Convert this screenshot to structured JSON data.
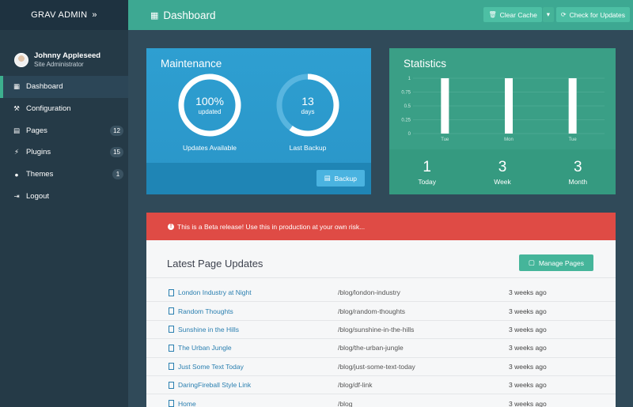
{
  "brand": {
    "title": "GRAV ADMIN",
    "chevron": "»"
  },
  "user": {
    "name": "Johnny Appleseed",
    "role": "Site Administrator"
  },
  "nav": [
    {
      "label": "Dashboard",
      "icon": "grid-icon",
      "active": true
    },
    {
      "label": "Configuration",
      "icon": "wrench-icon"
    },
    {
      "label": "Pages",
      "icon": "file-icon",
      "badge": "12"
    },
    {
      "label": "Plugins",
      "icon": "plug-icon",
      "badge": "15"
    },
    {
      "label": "Themes",
      "icon": "tint-icon",
      "badge": "1"
    },
    {
      "label": "Logout",
      "icon": "sign-out-icon"
    }
  ],
  "header": {
    "title": "Dashboard",
    "clear_cache": "Clear Cache",
    "check_updates": "Check for Updates"
  },
  "maintenance": {
    "title": "Maintenance",
    "updates_value": "100%",
    "updates_unit": "updated",
    "updates_label": "Updates Available",
    "updates_fraction": 1.0,
    "backup_value": "13",
    "backup_unit": "days",
    "backup_label": "Last Backup",
    "backup_fraction": 0.6,
    "backup_button": "Backup"
  },
  "statistics": {
    "title": "Statistics",
    "today_value": "1",
    "today_label": "Today",
    "week_value": "3",
    "week_label": "Week",
    "month_value": "3",
    "month_label": "Month"
  },
  "chart_data": {
    "type": "bar",
    "categories": [
      "Tue",
      "Mon",
      "Tue"
    ],
    "values": [
      1,
      1,
      1
    ],
    "yticks": [
      "1",
      "0.75",
      "0.5",
      "0.25",
      "0"
    ],
    "ylim": [
      0,
      1
    ],
    "grid": true
  },
  "alert": {
    "text": "This is a Beta release! Use this in production at your own risk..."
  },
  "updates": {
    "title": "Latest Page Updates",
    "manage_button": "Manage Pages",
    "rows": [
      {
        "title": "London Industry at Night",
        "route": "/blog/london-industry",
        "time": "3 weeks ago"
      },
      {
        "title": "Random Thoughts",
        "route": "/blog/random-thoughts",
        "time": "3 weeks ago"
      },
      {
        "title": "Sunshine in the Hills",
        "route": "/blog/sunshine-in-the-hills",
        "time": "3 weeks ago"
      },
      {
        "title": "The Urban Jungle",
        "route": "/blog/the-urban-jungle",
        "time": "3 weeks ago"
      },
      {
        "title": "Just Some Text Today",
        "route": "/blog/just-some-text-today",
        "time": "3 weeks ago"
      },
      {
        "title": "DaringFireball Style Link",
        "route": "/blog/df-link",
        "time": "3 weeks ago"
      },
      {
        "title": "Home",
        "route": "/blog",
        "time": "3 weeks ago"
      }
    ]
  },
  "colors": {
    "sidebar": "#253a47",
    "header": "#3da892",
    "maintenance": "#2e9fd1",
    "statistics": "#3a9f86",
    "alert": "#df4b45"
  }
}
